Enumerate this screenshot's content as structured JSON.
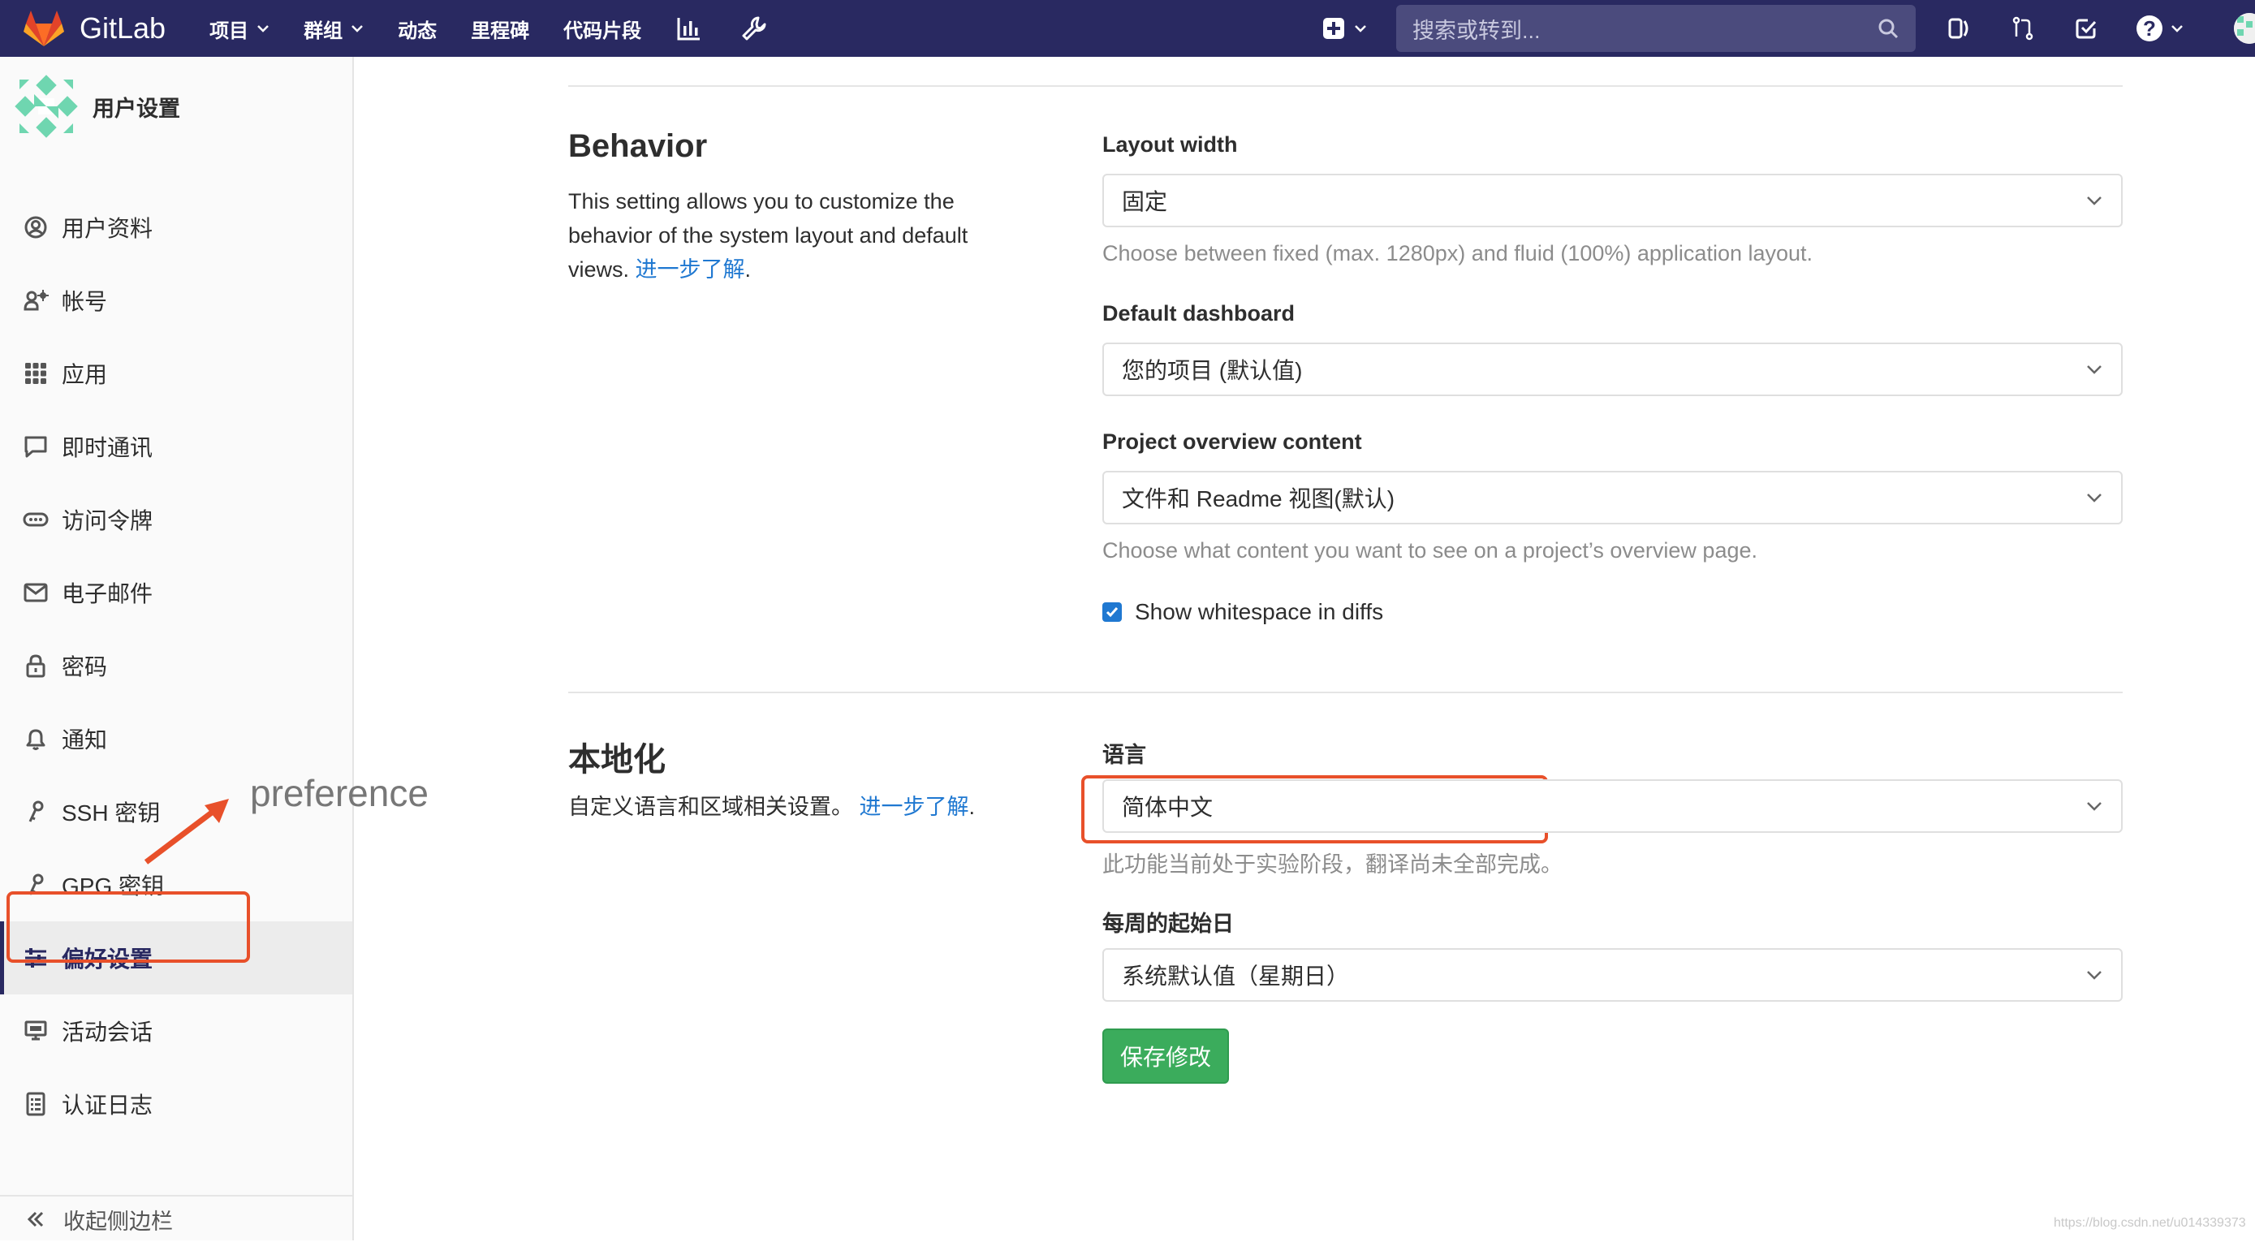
{
  "colors": {
    "navbar": "#292961",
    "link": "#1f78d1",
    "save_button": "#3bac5c",
    "annotation": "#e8502a",
    "help_text": "#8c8c8c"
  },
  "navbar": {
    "brand": "GitLab",
    "menu": [
      {
        "label": "项目",
        "dropdown": true
      },
      {
        "label": "群组",
        "dropdown": true
      },
      {
        "label": "动态",
        "dropdown": false
      },
      {
        "label": "里程碑",
        "dropdown": false
      },
      {
        "label": "代码片段",
        "dropdown": false
      }
    ],
    "icons": [
      "activity-chart-icon",
      "admin-wrench-icon"
    ],
    "new_icon": "plus-square-icon",
    "search_placeholder": "搜索或转到...",
    "right_icons": [
      "issues-icon",
      "merge-requests-icon",
      "todos-icon"
    ],
    "help_icon": "help-icon"
  },
  "sidebar": {
    "title": "用户设置",
    "items": [
      {
        "label": "用户资料",
        "icon": "profile-icon"
      },
      {
        "label": "帐号",
        "icon": "account-icon"
      },
      {
        "label": "应用",
        "icon": "applications-icon"
      },
      {
        "label": "即时通讯",
        "icon": "chat-icon"
      },
      {
        "label": "访问令牌",
        "icon": "token-icon"
      },
      {
        "label": "电子邮件",
        "icon": "email-icon"
      },
      {
        "label": "密码",
        "icon": "lock-icon"
      },
      {
        "label": "通知",
        "icon": "bell-icon"
      },
      {
        "label": "SSH 密钥",
        "icon": "key-icon"
      },
      {
        "label": "GPG 密钥",
        "icon": "key-icon"
      },
      {
        "label": "偏好设置",
        "icon": "preferences-icon",
        "active": true
      },
      {
        "label": "活动会话",
        "icon": "monitor-icon"
      },
      {
        "label": "认证日志",
        "icon": "log-icon"
      }
    ],
    "collapse_label": "收起侧边栏"
  },
  "annotation": {
    "text": "preference"
  },
  "behavior": {
    "title": "Behavior",
    "desc": "This setting allows you to customize the behavior of the system layout and default views.",
    "learn_more": "进一步了解",
    "layout_width": {
      "label": "Layout width",
      "value": "固定",
      "help": "Choose between fixed (max. 1280px) and fluid (100%) application layout."
    },
    "default_dashboard": {
      "label": "Default dashboard",
      "value": "您的项目 (默认值)"
    },
    "project_overview": {
      "label": "Project overview content",
      "value": "文件和 Readme 视图(默认)",
      "help": "Choose what content you want to see on a project’s overview page."
    },
    "show_whitespace": {
      "label": "Show whitespace in diffs",
      "checked": true
    }
  },
  "localization": {
    "title": "本地化",
    "desc": "自定义语言和区域相关设置。",
    "learn_more": "进一步了解",
    "language": {
      "label": "语言",
      "value": "简体中文",
      "help": "此功能当前处于实验阶段，翻译尚未全部完成。"
    },
    "first_day": {
      "label": "每周的起始日",
      "value": "系统默认值（星期日）"
    },
    "save_label": "保存修改"
  },
  "watermark": "https://blog.csdn.net/u014339373"
}
